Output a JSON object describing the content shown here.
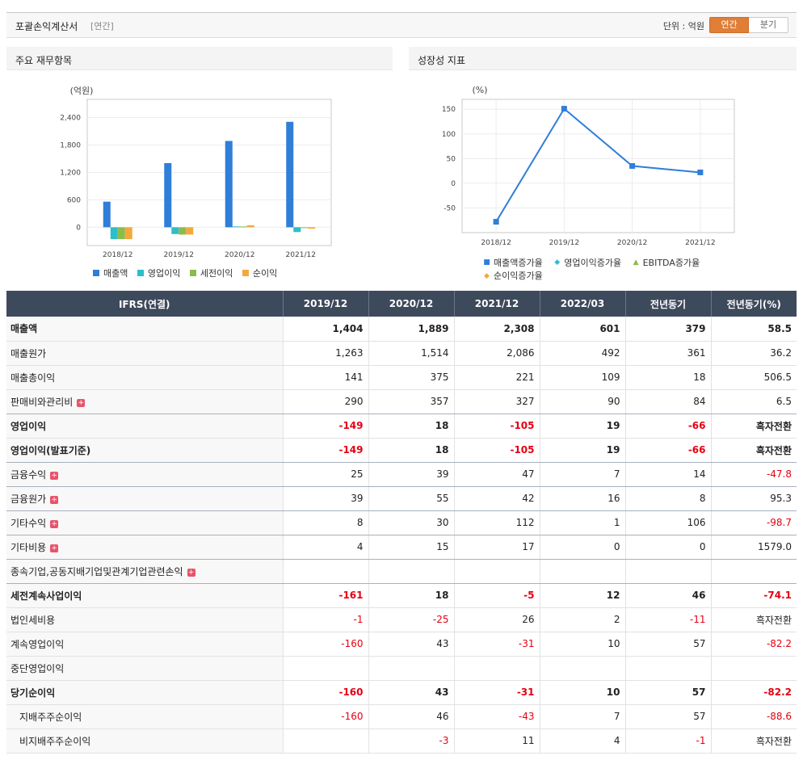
{
  "header": {
    "title": "포괄손익계산서",
    "period_tag": "[연간]",
    "unit": "단위 : 억원",
    "tabs": [
      {
        "label": "연간",
        "active": true
      },
      {
        "label": "분기",
        "active": false
      }
    ]
  },
  "left_panel": {
    "title": "주요 재무항목",
    "chart_data": {
      "type": "bar",
      "ylabel": "(억원)",
      "ylim": [
        -400,
        2800
      ],
      "yticks": [
        0,
        600,
        1200,
        1800,
        2400
      ],
      "ytick_labels": [
        "0",
        "600",
        "1,200",
        "1,800",
        "2,400"
      ],
      "categories": [
        "2018/12",
        "2019/12",
        "2020/12",
        "2021/12"
      ],
      "series": [
        {
          "name": "매출액",
          "color": "#2f7ed8",
          "values": [
            560,
            1404,
            1889,
            2308
          ]
        },
        {
          "name": "영업이익",
          "color": "#2ebdc9",
          "values": [
            -260,
            -149,
            18,
            -105
          ]
        },
        {
          "name": "세전이익",
          "color": "#8bbc4a",
          "values": [
            -260,
            -161,
            18,
            -5
          ]
        },
        {
          "name": "순이익",
          "color": "#f4a83c",
          "values": [
            -260,
            -160,
            43,
            -31
          ]
        }
      ]
    }
  },
  "right_panel": {
    "title": "성장성 지표",
    "chart_data": {
      "type": "line",
      "ylabel": "(%)",
      "ylim": [
        -100,
        170
      ],
      "yticks": [
        -50,
        0,
        50,
        100,
        150
      ],
      "ytick_labels": [
        "-50",
        "0",
        "50",
        "100",
        "150"
      ],
      "categories": [
        "2018/12",
        "2019/12",
        "2020/12",
        "2021/12"
      ],
      "series": [
        {
          "name": "매출액증가율",
          "color": "#2f7ed8",
          "marker": "■",
          "values": [
            -78,
            151,
            35,
            22
          ]
        },
        {
          "name": "영업이익증가율",
          "color": "#2ebdc9",
          "marker": "◆",
          "values": []
        },
        {
          "name": "EBITDA증가율",
          "color": "#8bbc4a",
          "marker": "▲",
          "values": []
        },
        {
          "name": "순이익증가율",
          "color": "#f4a83c",
          "marker": "◆",
          "values": []
        }
      ]
    }
  },
  "table": {
    "columns": [
      "IFRS(연결)",
      "2019/12",
      "2020/12",
      "2021/12",
      "2022/03",
      "전년동기",
      "전년동기(%)"
    ],
    "rows": [
      {
        "label": "매출액",
        "values": [
          "1,404",
          "1,889",
          "2,308",
          "601",
          "379",
          "58.5"
        ],
        "bold": true,
        "major": false,
        "expand": false,
        "sub": false
      },
      {
        "label": "매출원가",
        "values": [
          "1,263",
          "1,514",
          "2,086",
          "492",
          "361",
          "36.2"
        ],
        "bold": false,
        "major": false,
        "expand": false,
        "sub": false
      },
      {
        "label": "매출총이익",
        "values": [
          "141",
          "375",
          "221",
          "109",
          "18",
          "506.5"
        ],
        "bold": false,
        "major": false,
        "expand": false,
        "sub": false
      },
      {
        "label": "판매비와관리비",
        "values": [
          "290",
          "357",
          "327",
          "90",
          "84",
          "6.5"
        ],
        "bold": false,
        "major": true,
        "expand": true,
        "sub": false
      },
      {
        "label": "영업이익",
        "values": [
          "-149",
          "18",
          "-105",
          "19",
          "-66",
          "흑자전환"
        ],
        "bold": true,
        "major": false,
        "expand": false,
        "sub": false
      },
      {
        "label": "영업이익(발표기준)",
        "values": [
          "-149",
          "18",
          "-105",
          "19",
          "-66",
          "흑자전환"
        ],
        "bold": true,
        "major": true,
        "expand": false,
        "sub": false
      },
      {
        "label": "금융수익",
        "values": [
          "25",
          "39",
          "47",
          "7",
          "14",
          "-47.8"
        ],
        "bold": false,
        "major": true,
        "expand": true,
        "sub": false
      },
      {
        "label": "금융원가",
        "values": [
          "39",
          "55",
          "42",
          "16",
          "8",
          "95.3"
        ],
        "bold": false,
        "major": true,
        "expand": true,
        "sub": false
      },
      {
        "label": "기타수익",
        "values": [
          "8",
          "30",
          "112",
          "1",
          "106",
          "-98.7"
        ],
        "bold": false,
        "major": true,
        "expand": true,
        "sub": false
      },
      {
        "label": "기타비용",
        "values": [
          "4",
          "15",
          "17",
          "0",
          "0",
          "1579.0"
        ],
        "bold": false,
        "major": true,
        "expand": true,
        "sub": false
      },
      {
        "label": "종속기업,공동지배기업및관계기업관련손익",
        "values": [
          "",
          "",
          "",
          "",
          "",
          ""
        ],
        "bold": false,
        "major": true,
        "expand": true,
        "sub": false
      },
      {
        "label": "세전계속사업이익",
        "values": [
          "-161",
          "18",
          "-5",
          "12",
          "46",
          "-74.1"
        ],
        "bold": true,
        "major": false,
        "expand": false,
        "sub": false
      },
      {
        "label": "법인세비용",
        "values": [
          "-1",
          "-25",
          "26",
          "2",
          "-11",
          "흑자전환"
        ],
        "bold": false,
        "major": false,
        "expand": false,
        "sub": false
      },
      {
        "label": "계속영업이익",
        "values": [
          "-160",
          "43",
          "-31",
          "10",
          "57",
          "-82.2"
        ],
        "bold": false,
        "major": false,
        "expand": false,
        "sub": false
      },
      {
        "label": "중단영업이익",
        "values": [
          "",
          "",
          "",
          "",
          "",
          ""
        ],
        "bold": false,
        "major": false,
        "expand": false,
        "sub": false
      },
      {
        "label": "당기순이익",
        "values": [
          "-160",
          "43",
          "-31",
          "10",
          "57",
          "-82.2"
        ],
        "bold": true,
        "major": false,
        "expand": false,
        "sub": false
      },
      {
        "label": "지배주주순이익",
        "values": [
          "-160",
          "46",
          "-43",
          "7",
          "57",
          "-88.6"
        ],
        "bold": false,
        "major": false,
        "expand": false,
        "sub": true
      },
      {
        "label": "비지배주주순이익",
        "values": [
          "",
          "-3",
          "11",
          "4",
          "-1",
          "흑자전환"
        ],
        "bold": false,
        "major": false,
        "expand": false,
        "sub": true
      }
    ]
  }
}
